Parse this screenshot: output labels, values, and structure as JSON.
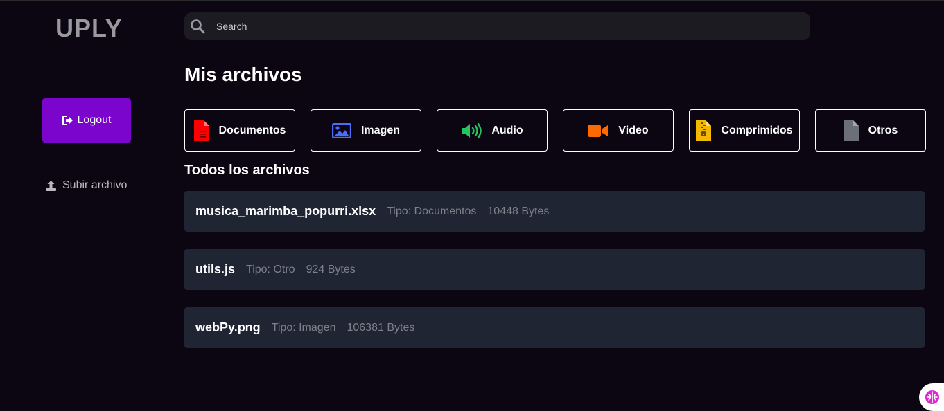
{
  "brand": {
    "logo_text": "UPLY"
  },
  "sidebar": {
    "logout_label": "Logout",
    "upload_label": "Subir archivo"
  },
  "search": {
    "placeholder": "Search",
    "value": ""
  },
  "main": {
    "title": "Mis archivos",
    "section_title": "Todos los archivos",
    "categories": [
      {
        "label": "Documentos",
        "icon": "document-icon",
        "color": "#ff0000"
      },
      {
        "label": "Imagen",
        "icon": "image-icon",
        "color": "#4e6bff"
      },
      {
        "label": "Audio",
        "icon": "volume-icon",
        "color": "#22c55e"
      },
      {
        "label": "Video",
        "icon": "video-camera-icon",
        "color": "#ff6a00"
      },
      {
        "label": "Comprimidos",
        "icon": "zip-file-icon",
        "color": "#f5b800"
      },
      {
        "label": "Otros",
        "icon": "file-icon",
        "color": "#6b6f78"
      }
    ],
    "files": [
      {
        "name": "musica_marimba_popurri.xlsx",
        "type": "Tipo: Documentos",
        "size": "10448 Bytes"
      },
      {
        "name": "utils.js",
        "type": "Tipo: Otro",
        "size": "924 Bytes"
      },
      {
        "name": "webPy.png",
        "type": "Tipo: Imagen",
        "size": "106381 Bytes"
      }
    ]
  },
  "colors": {
    "background": "#0b0611",
    "accent": "#7b05cc",
    "card": "#1f2533"
  }
}
